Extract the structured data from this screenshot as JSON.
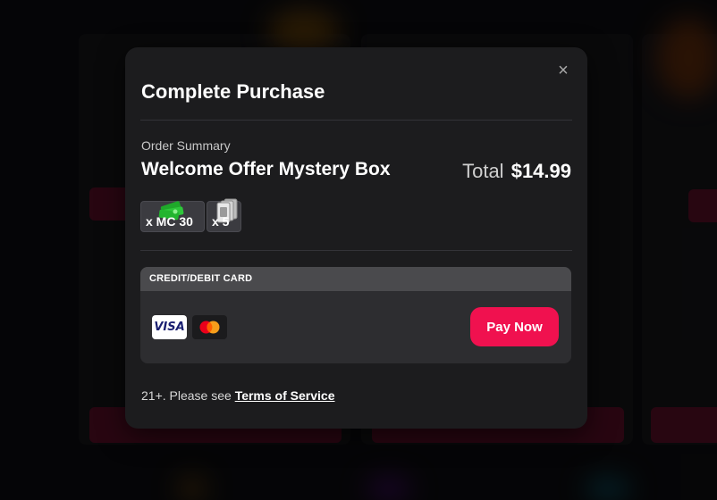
{
  "modal": {
    "title": "Complete Purchase",
    "close_icon": "close-icon",
    "order_summary_label": "Order Summary",
    "product_name": "Welcome Offer Mystery Box",
    "total_label": "Total",
    "total_amount": "$14.99",
    "items": [
      {
        "icon": "cash-stack-icon",
        "label": "x MC 30"
      },
      {
        "icon": "cards-icon",
        "label": "x 5"
      }
    ],
    "payment": {
      "method_header": "CREDIT/DEBIT CARD",
      "card_brands": [
        "VISA",
        "Mastercard"
      ],
      "pay_button": "Pay Now"
    },
    "footer": {
      "notice": "21+. Please see",
      "tos_link": "Terms of Service"
    }
  },
  "colors": {
    "accent": "#f0114f",
    "modal_bg": "#1c1c1e",
    "panel_bg": "#2d2d30",
    "panel_header_bg": "#4a4a4d"
  }
}
